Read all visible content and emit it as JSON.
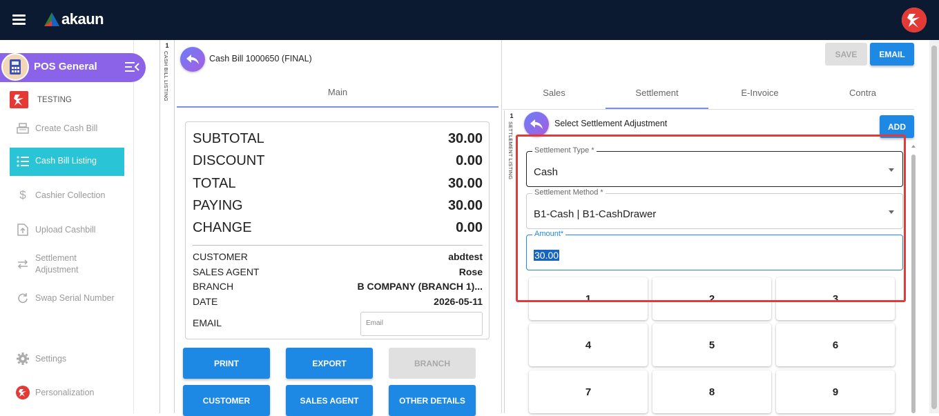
{
  "topbar": {
    "logo_text": "akaun"
  },
  "sidebar": {
    "app_title": "POS General",
    "org_label": "TESTING",
    "items": [
      {
        "label": "Create Cash Bill"
      },
      {
        "label": "Cash Bill Listing"
      },
      {
        "label": "Cashier Collection"
      },
      {
        "label": "Upload Cashbill"
      },
      {
        "label": "Settlement",
        "label2": "Adjustment"
      },
      {
        "label": "Swap Serial Number"
      },
      {
        "label": "Settings"
      },
      {
        "label": "Personalization"
      }
    ]
  },
  "listing_strip": {
    "count": "1",
    "label": "CASH BILL LISTING"
  },
  "settlement_strip": {
    "count": "1",
    "label": "SETTLEMENT LISTING"
  },
  "bill": {
    "title": "Cash Bill 1000650 (FINAL)",
    "tab_main": "Main",
    "summary": [
      {
        "label": "SUBTOTAL",
        "value": "30.00"
      },
      {
        "label": "DISCOUNT",
        "value": "0.00"
      },
      {
        "label": "TOTAL",
        "value": "30.00"
      },
      {
        "label": "PAYING",
        "value": "30.00"
      },
      {
        "label": "CHANGE",
        "value": "0.00"
      }
    ],
    "info": [
      {
        "label": "CUSTOMER",
        "value": "abdtest"
      },
      {
        "label": "SALES AGENT",
        "value": "Rose"
      },
      {
        "label": "BRANCH",
        "value": "B COMPANY (BRANCH 1)..."
      },
      {
        "label": "DATE",
        "value": "2026-05-11"
      }
    ],
    "email_label": "EMAIL",
    "email_placeholder": "Email",
    "buttons": {
      "print": "PRINT",
      "export": "EXPORT",
      "branch": "BRANCH",
      "customer": "CUSTOMER",
      "sales_agent": "SALES AGENT",
      "other_details": "OTHER DETAILS"
    }
  },
  "settlement": {
    "save": "SAVE",
    "email": "EMAIL",
    "tabs": [
      "Sales",
      "Settlement",
      "E-Invoice",
      "Contra"
    ],
    "active_tab": "Settlement",
    "title": "Select Settlement Adjustment",
    "add": "ADD",
    "type_label": "Settlement Type *",
    "type_value": "Cash",
    "method_label": "Settlement Method *",
    "method_value": "B1-Cash | B1-CashDrawer",
    "amount_label": "Amount*",
    "amount_value": "30.00",
    "keypad": [
      "1",
      "2",
      "3",
      "4",
      "5",
      "6",
      "7",
      "8",
      "9"
    ]
  },
  "colors": {
    "topbar": "#0b1a30",
    "app_header": "#8a63e8",
    "active_item": "#29c4d5",
    "primary_button": "#1e88e5",
    "highlight_box": "#e53935"
  }
}
